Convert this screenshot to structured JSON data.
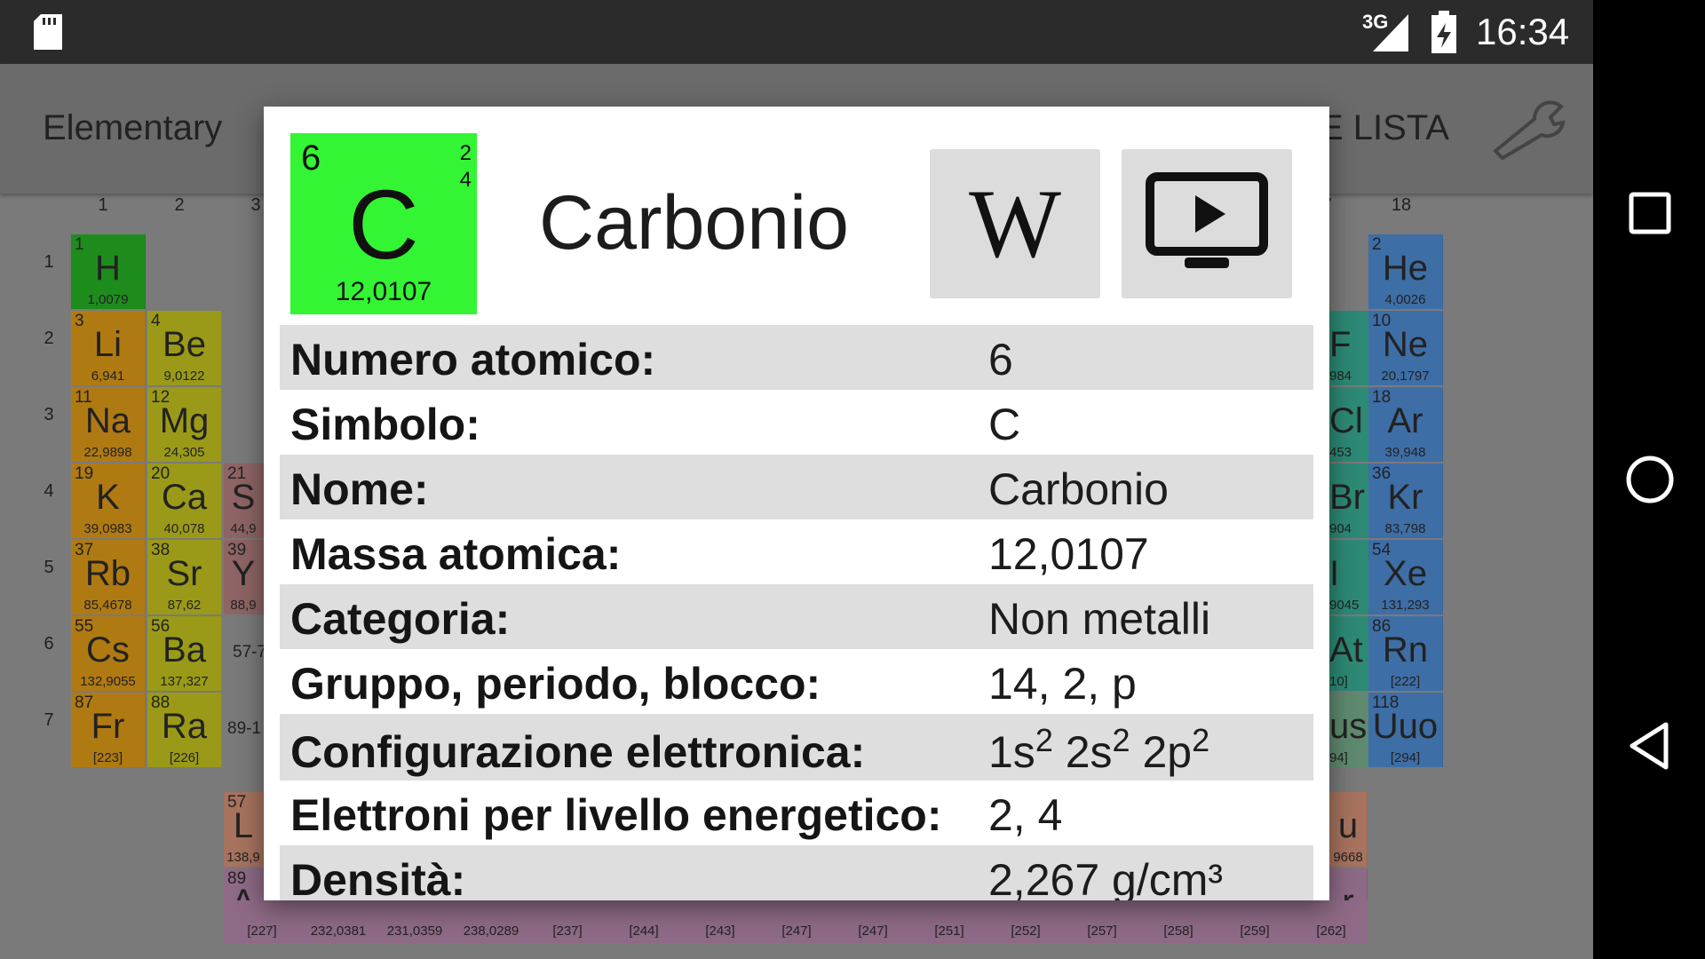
{
  "status_bar": {
    "time": "16:34",
    "network": "3G"
  },
  "app_bar": {
    "title": "Elementary",
    "list_label": "E LISTA",
    "settings_icon": "wrench-icon"
  },
  "table": {
    "group_labels": [
      "1",
      "2",
      "3",
      "7",
      "18"
    ],
    "period_labels": [
      "1",
      "2",
      "3",
      "4",
      "5",
      "6",
      "7"
    ],
    "lanthanide_ref": "57-7",
    "actinide_ref": "89-1",
    "left_cells": [
      {
        "num": "1",
        "sym": "H",
        "mass": "1,0079",
        "color": "#1d8c1d"
      },
      {
        "num": "3",
        "sym": "Li",
        "mass": "6,941",
        "color": "#b07a12"
      },
      {
        "num": "4",
        "sym": "Be",
        "mass": "9,0122",
        "color": "#9a9a18"
      },
      {
        "num": "11",
        "sym": "Na",
        "mass": "22,9898",
        "color": "#b07a12"
      },
      {
        "num": "12",
        "sym": "Mg",
        "mass": "24,305",
        "color": "#9a9a18"
      },
      {
        "num": "19",
        "sym": "K",
        "mass": "39,0983",
        "color": "#b07a12"
      },
      {
        "num": "20",
        "sym": "Ca",
        "mass": "40,078",
        "color": "#9a9a18"
      },
      {
        "num": "37",
        "sym": "Rb",
        "mass": "85,4678",
        "color": "#b07a12"
      },
      {
        "num": "38",
        "sym": "Sr",
        "mass": "87,62",
        "color": "#9a9a18"
      },
      {
        "num": "55",
        "sym": "Cs",
        "mass": "132,9055",
        "color": "#b07a12"
      },
      {
        "num": "56",
        "sym": "Ba",
        "mass": "137,327",
        "color": "#9a9a18"
      },
      {
        "num": "87",
        "sym": "Fr",
        "mass": "[223]",
        "color": "#b07a12"
      },
      {
        "num": "88",
        "sym": "Ra",
        "mass": "[226]",
        "color": "#9a9a18"
      }
    ],
    "partial_left_cells": [
      {
        "num": "21",
        "sym": "S",
        "mass": "44,9",
        "color": "#8e6464"
      },
      {
        "num": "39",
        "sym": "Y",
        "mass": "88,9",
        "color": "#8e6464"
      }
    ],
    "noble_cells": [
      {
        "num": "2",
        "sym": "He",
        "mass": "4,0026",
        "color": "#3e6ea6"
      },
      {
        "num": "10",
        "sym": "Ne",
        "mass": "20,1797",
        "color": "#3e6ea6"
      },
      {
        "num": "18",
        "sym": "Ar",
        "mass": "39,948",
        "color": "#3e6ea6"
      },
      {
        "num": "36",
        "sym": "Kr",
        "mass": "83,798",
        "color": "#3e6ea6"
      },
      {
        "num": "54",
        "sym": "Xe",
        "mass": "131,293",
        "color": "#3e6ea6"
      },
      {
        "num": "86",
        "sym": "Rn",
        "mass": "[222]",
        "color": "#3e6ea6"
      },
      {
        "num": "118",
        "sym": "Uuo",
        "mass": "[294]",
        "color": "#3e6ea6"
      }
    ],
    "halogen_cells": [
      {
        "sym": "F",
        "mass": "984"
      },
      {
        "sym": "Cl",
        "mass": "453"
      },
      {
        "sym": "Br",
        "mass": "904"
      },
      {
        "sym": "I",
        "mass": "9045"
      },
      {
        "sym": "At",
        "mass": "10]"
      },
      {
        "sym": "us",
        "mass": "94]"
      }
    ],
    "lanthanide_partial": {
      "num": "57",
      "sym": "L",
      "mass": "138,9"
    },
    "actinide_partial": {
      "num": "89",
      "sym": "A",
      "mass": ""
    },
    "lanthanide_tail": {
      "sym": "u",
      "mass": "9668"
    },
    "actinide_tail": {
      "sym": "r",
      "mass": ""
    },
    "actinide_masses": [
      "[227]",
      "232,0381",
      "231,0359",
      "238,0289",
      "[237]",
      "[244]",
      "[243]",
      "[247]",
      "[247]",
      "[251]",
      "[252]",
      "[257]",
      "[258]",
      "[259]",
      "[262]"
    ]
  },
  "dialog": {
    "tile": {
      "number": "6",
      "shells": [
        "2",
        "4"
      ],
      "symbol": "C",
      "mass": "12,0107",
      "color": "#33f533"
    },
    "title": "Carbonio",
    "wiki_icon": "wikipedia-icon",
    "wiki_glyph": "W",
    "video_icon": "video-play-icon",
    "rows": [
      {
        "label": "Numero atomico:",
        "value": "6"
      },
      {
        "label": "Simbolo:",
        "value": "C"
      },
      {
        "label": "Nome:",
        "value": "Carbonio"
      },
      {
        "label": "Massa atomica:",
        "value": "12,0107"
      },
      {
        "label": "Categoria:",
        "value": "Non metalli"
      },
      {
        "label": "Gruppo, periodo, blocco:",
        "value": "14, 2, p"
      },
      {
        "label": "Configurazione elettronica:",
        "value_parts": [
          {
            "base": "1s",
            "sup": "2"
          },
          {
            "base": " 2s",
            "sup": "2"
          },
          {
            "base": " 2p",
            "sup": "2"
          }
        ]
      },
      {
        "label": "Elettroni per livello energetico:",
        "value": "2, 4"
      },
      {
        "label": "Densità:",
        "value": "2,267 g/cm³"
      }
    ]
  },
  "nav_bar": {
    "recents_icon": "recents-square-icon",
    "home_icon": "home-circle-icon",
    "back_icon": "back-triangle-icon"
  }
}
